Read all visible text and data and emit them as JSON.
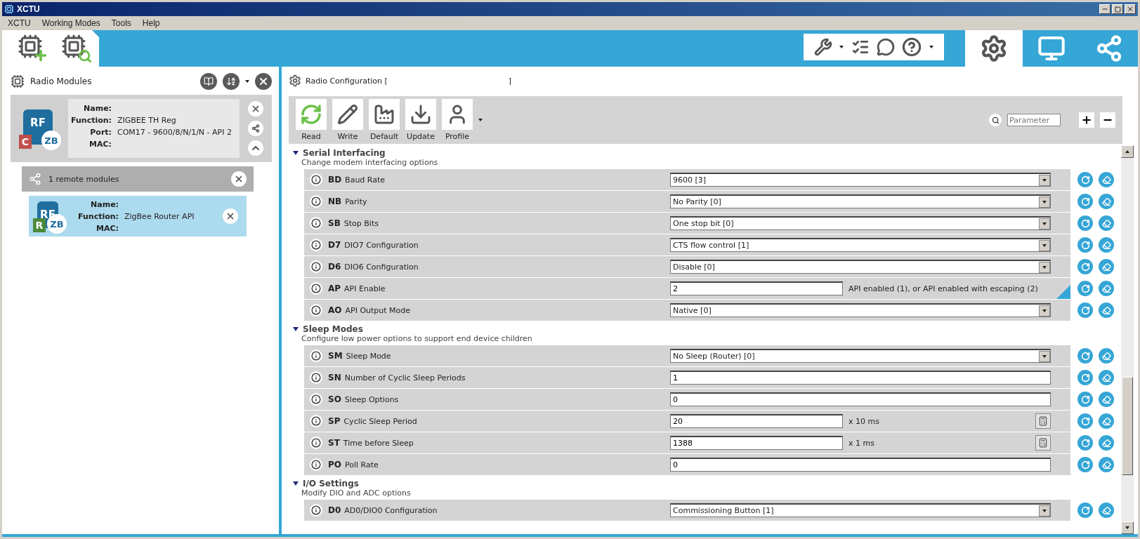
{
  "window": {
    "title": "XCTU"
  },
  "menu": [
    "XCTU",
    "Working Modes",
    "Tools",
    "Help"
  ],
  "mode_tabs": [
    {
      "kind": "configuration",
      "selected": true
    },
    {
      "kind": "console",
      "selected": false
    },
    {
      "kind": "network",
      "selected": false
    }
  ],
  "left_panel": {
    "title": "Radio Modules",
    "local_module": {
      "chip": "RF",
      "protocol": "ZB",
      "badge": "C",
      "fields": [
        {
          "label": "Name:"
        },
        {
          "label": "Function:",
          "value": "ZIGBEE TH Reg"
        },
        {
          "label": "Port:",
          "value": "COM17 - 9600/8/N/1/N - API 2"
        },
        {
          "label": "MAC:"
        }
      ]
    },
    "remote_group": {
      "label": "1 remote modules",
      "modules": [
        {
          "chip": "RF",
          "protocol": "ZB",
          "badge": "R",
          "selected": true,
          "fields": [
            {
              "label": "Name:"
            },
            {
              "label": "Function:",
              "value": "ZigBee Router API"
            },
            {
              "label": "MAC:"
            }
          ]
        }
      ]
    }
  },
  "config": {
    "title": "Radio Configuration [",
    "title_close": "]",
    "actions": [
      {
        "kind": "read",
        "label": "Read"
      },
      {
        "kind": "write",
        "label": "Write"
      },
      {
        "kind": "default",
        "label": "Default"
      },
      {
        "kind": "update",
        "label": "Update"
      },
      {
        "kind": "profile",
        "label": "Profile"
      }
    ],
    "search": {
      "placeholder": "Parameter"
    },
    "sections": [
      {
        "title": "Serial Interfacing",
        "subtitle": "Change modem interfacing options",
        "rows": [
          {
            "code": "BD",
            "name": "Baud Rate",
            "kind": "select",
            "value": "9600 [3]",
            "changed": false
          },
          {
            "code": "NB",
            "name": "Parity",
            "kind": "select",
            "value": "No Parity [0]",
            "changed": false
          },
          {
            "code": "SB",
            "name": "Stop Bits",
            "kind": "select",
            "value": "One stop bit [0]",
            "changed": false
          },
          {
            "code": "D7",
            "name": "DIO7 Configuration",
            "kind": "select",
            "value": "CTS flow control [1]",
            "changed": false
          },
          {
            "code": "D6",
            "name": "DIO6 Configuration",
            "kind": "select",
            "value": "Disable [0]",
            "changed": false
          },
          {
            "code": "AP",
            "name": "API Enable",
            "kind": "text",
            "value": "2",
            "hint": "API enabled (1), or API enabled with escaping (2)",
            "changed": true
          },
          {
            "code": "AO",
            "name": "API Output Mode",
            "kind": "select",
            "value": "Native [0]",
            "changed": false
          }
        ]
      },
      {
        "title": "Sleep Modes",
        "subtitle": "Configure low power options to support end device children",
        "rows": [
          {
            "code": "SM",
            "name": "Sleep Mode",
            "kind": "select",
            "value": "No Sleep (Router) [0]",
            "changed": false
          },
          {
            "code": "SN",
            "name": "Number of Cyclic Sleep Periods",
            "kind": "text",
            "value": "1",
            "changed": false
          },
          {
            "code": "SO",
            "name": "Sleep Options",
            "kind": "text",
            "value": "0",
            "changed": false
          },
          {
            "code": "SP",
            "name": "Cyclic Sleep Period",
            "kind": "text",
            "value": "20",
            "hint": "x 10 ms",
            "calculator": true,
            "changed": false
          },
          {
            "code": "ST",
            "name": "Time before Sleep",
            "kind": "text",
            "value": "1388",
            "hint": "x 1 ms",
            "calculator": true,
            "changed": false
          },
          {
            "code": "PO",
            "name": "Poll Rate",
            "kind": "text",
            "value": "0",
            "changed": false
          }
        ]
      },
      {
        "title": "I/O Settings",
        "subtitle": "Modify DIO and ADC options",
        "rows": [
          {
            "code": "D0",
            "name": "AD0/DIO0 Configuration",
            "kind": "select",
            "value": "Commissioning Button [1]",
            "changed": false
          }
        ]
      }
    ]
  }
}
